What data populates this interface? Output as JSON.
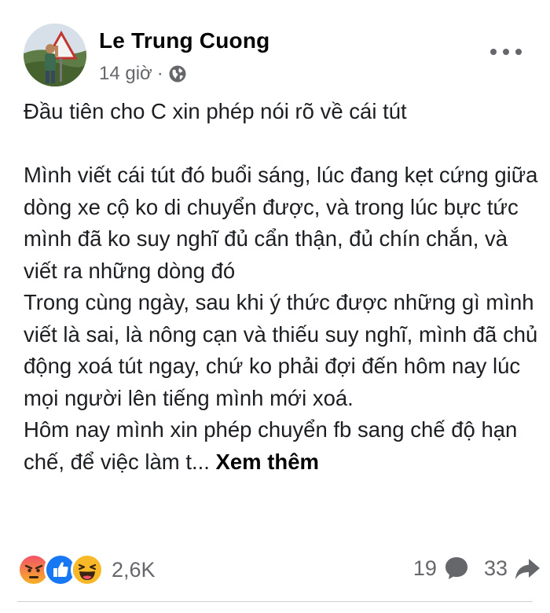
{
  "post": {
    "author": "Le Trung Cuong",
    "time": "14 giờ",
    "separator": "·",
    "privacy_icon": "globe-icon",
    "more_icon": "more-options-icon",
    "paragraphs": [
      "Đầu tiên cho C xin phép nói rõ về cái tút",
      "Mình viết cái tút đó buổi sáng, lúc đang kẹt cứng giữa dòng xe cộ ko di chuyển được, và trong lúc bực tức mình đã ko suy nghĩ đủ cẩn thận, đủ chín chắn, và viết ra những dòng đó",
      "Trong cùng ngày, sau khi ý thức được những gì mình viết là sai, là nông cạn và thiếu suy nghĩ, mình đã chủ động xoá tút ngay, chứ ko phải đợi đến hôm nay lúc mọi người lên tiếng mình mới xoá.",
      "Hôm nay mình xin phép chuyển fb sang chế độ hạn chế, để việc làm t..."
    ],
    "see_more": "Xem thêm"
  },
  "footer": {
    "reaction_icons": [
      "angry-reaction-icon",
      "like-reaction-icon",
      "haha-reaction-icon"
    ],
    "reaction_count": "2,6K",
    "comment_count": "19",
    "share_count": "33"
  },
  "colors": {
    "text": "#050505",
    "meta": "#65676b",
    "like_blue": "#1877f2",
    "angry_top": "#f35369",
    "angry_bottom": "#f7b125",
    "haha": "#f7b928"
  }
}
